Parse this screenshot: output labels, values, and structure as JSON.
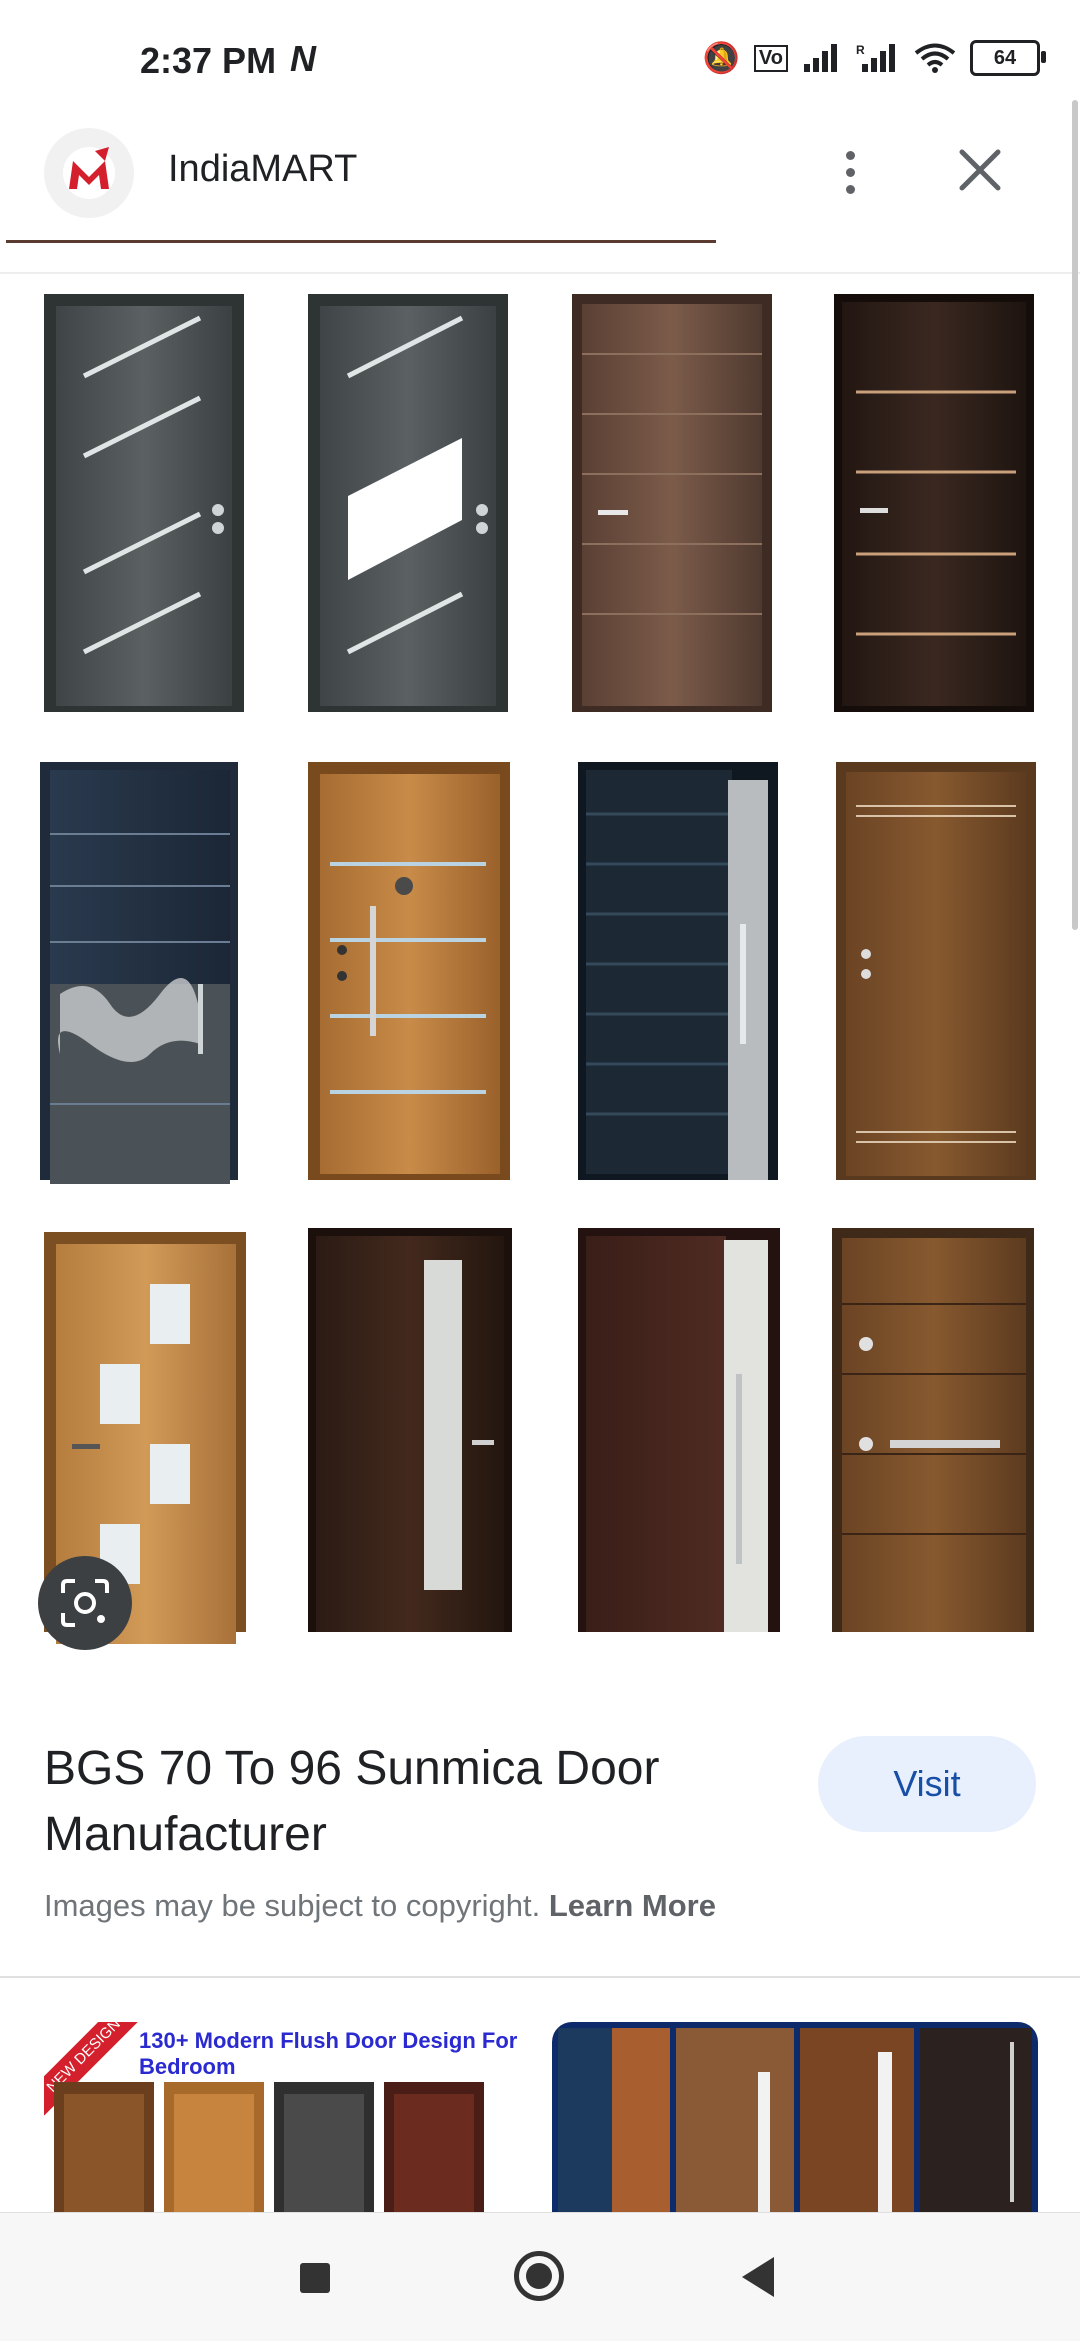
{
  "status_bar": {
    "time": "2:37 PM",
    "battery": "64"
  },
  "header": {
    "site_name": "IndiaMART"
  },
  "image_info": {
    "title": "BGS 70 To 96 Sunmica Door Manufacturer",
    "visit_label": "Visit",
    "copyright_text": "Images may be subject to copyright. ",
    "learn_more": "Learn More"
  },
  "related": {
    "thumb1_banner": "130+ Modern Flush Door Design For Bedroom",
    "thumb1_ribbon": "NEW DESIGN"
  },
  "colors": {
    "accent": "#174ea6",
    "visit_bg": "#e8f0fe",
    "brand_red": "#d3202c"
  }
}
